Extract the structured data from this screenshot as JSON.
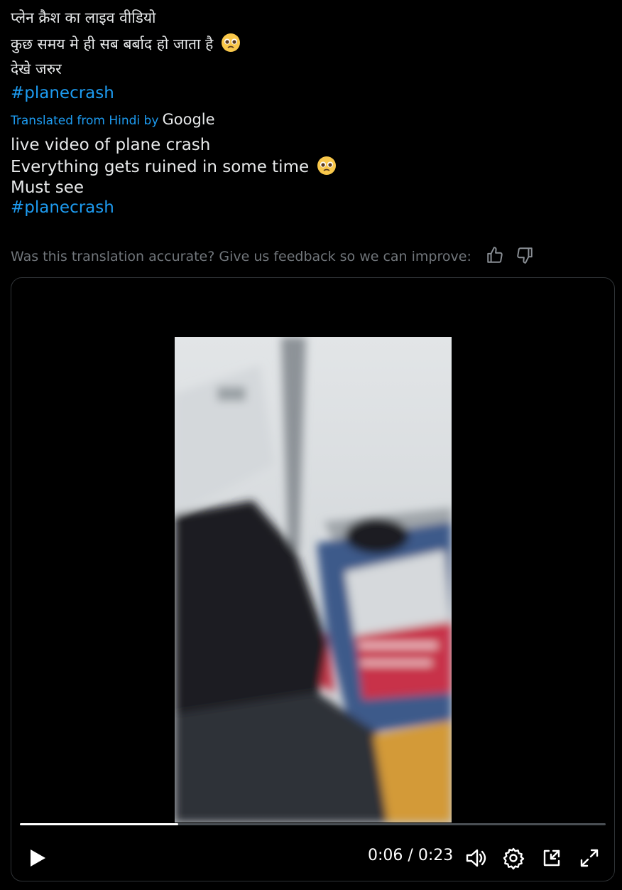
{
  "tweet": {
    "hindi_lines": [
      "प्लेन क्रैश का लाइव वीडियो",
      "कुछ समय मे ही सब बर्बाद हो जाता है",
      "देखे जरुर"
    ],
    "hindi_hashtag": "#planecrash",
    "translated_label": "Translated from Hindi by",
    "translator": "Google",
    "english_lines": [
      "live video of plane crash",
      "Everything gets ruined in some time",
      "Must see"
    ],
    "english_hashtag": "#planecrash",
    "emoji": "pleading-face-emoji",
    "feedback_text": "Was this translation accurate? Give us feedback so we can improve:"
  },
  "video": {
    "current_time": "0:06",
    "separator": "/",
    "duration": "0:23",
    "progress_fraction": 0.27
  },
  "colors": {
    "link": "#1d9bf0",
    "muted": "#71767b",
    "background": "#000000"
  },
  "icons": [
    "thumbs-up-icon",
    "thumbs-down-icon",
    "play-icon",
    "volume-icon",
    "settings-gear-icon",
    "picture-in-picture-icon",
    "fullscreen-icon"
  ]
}
